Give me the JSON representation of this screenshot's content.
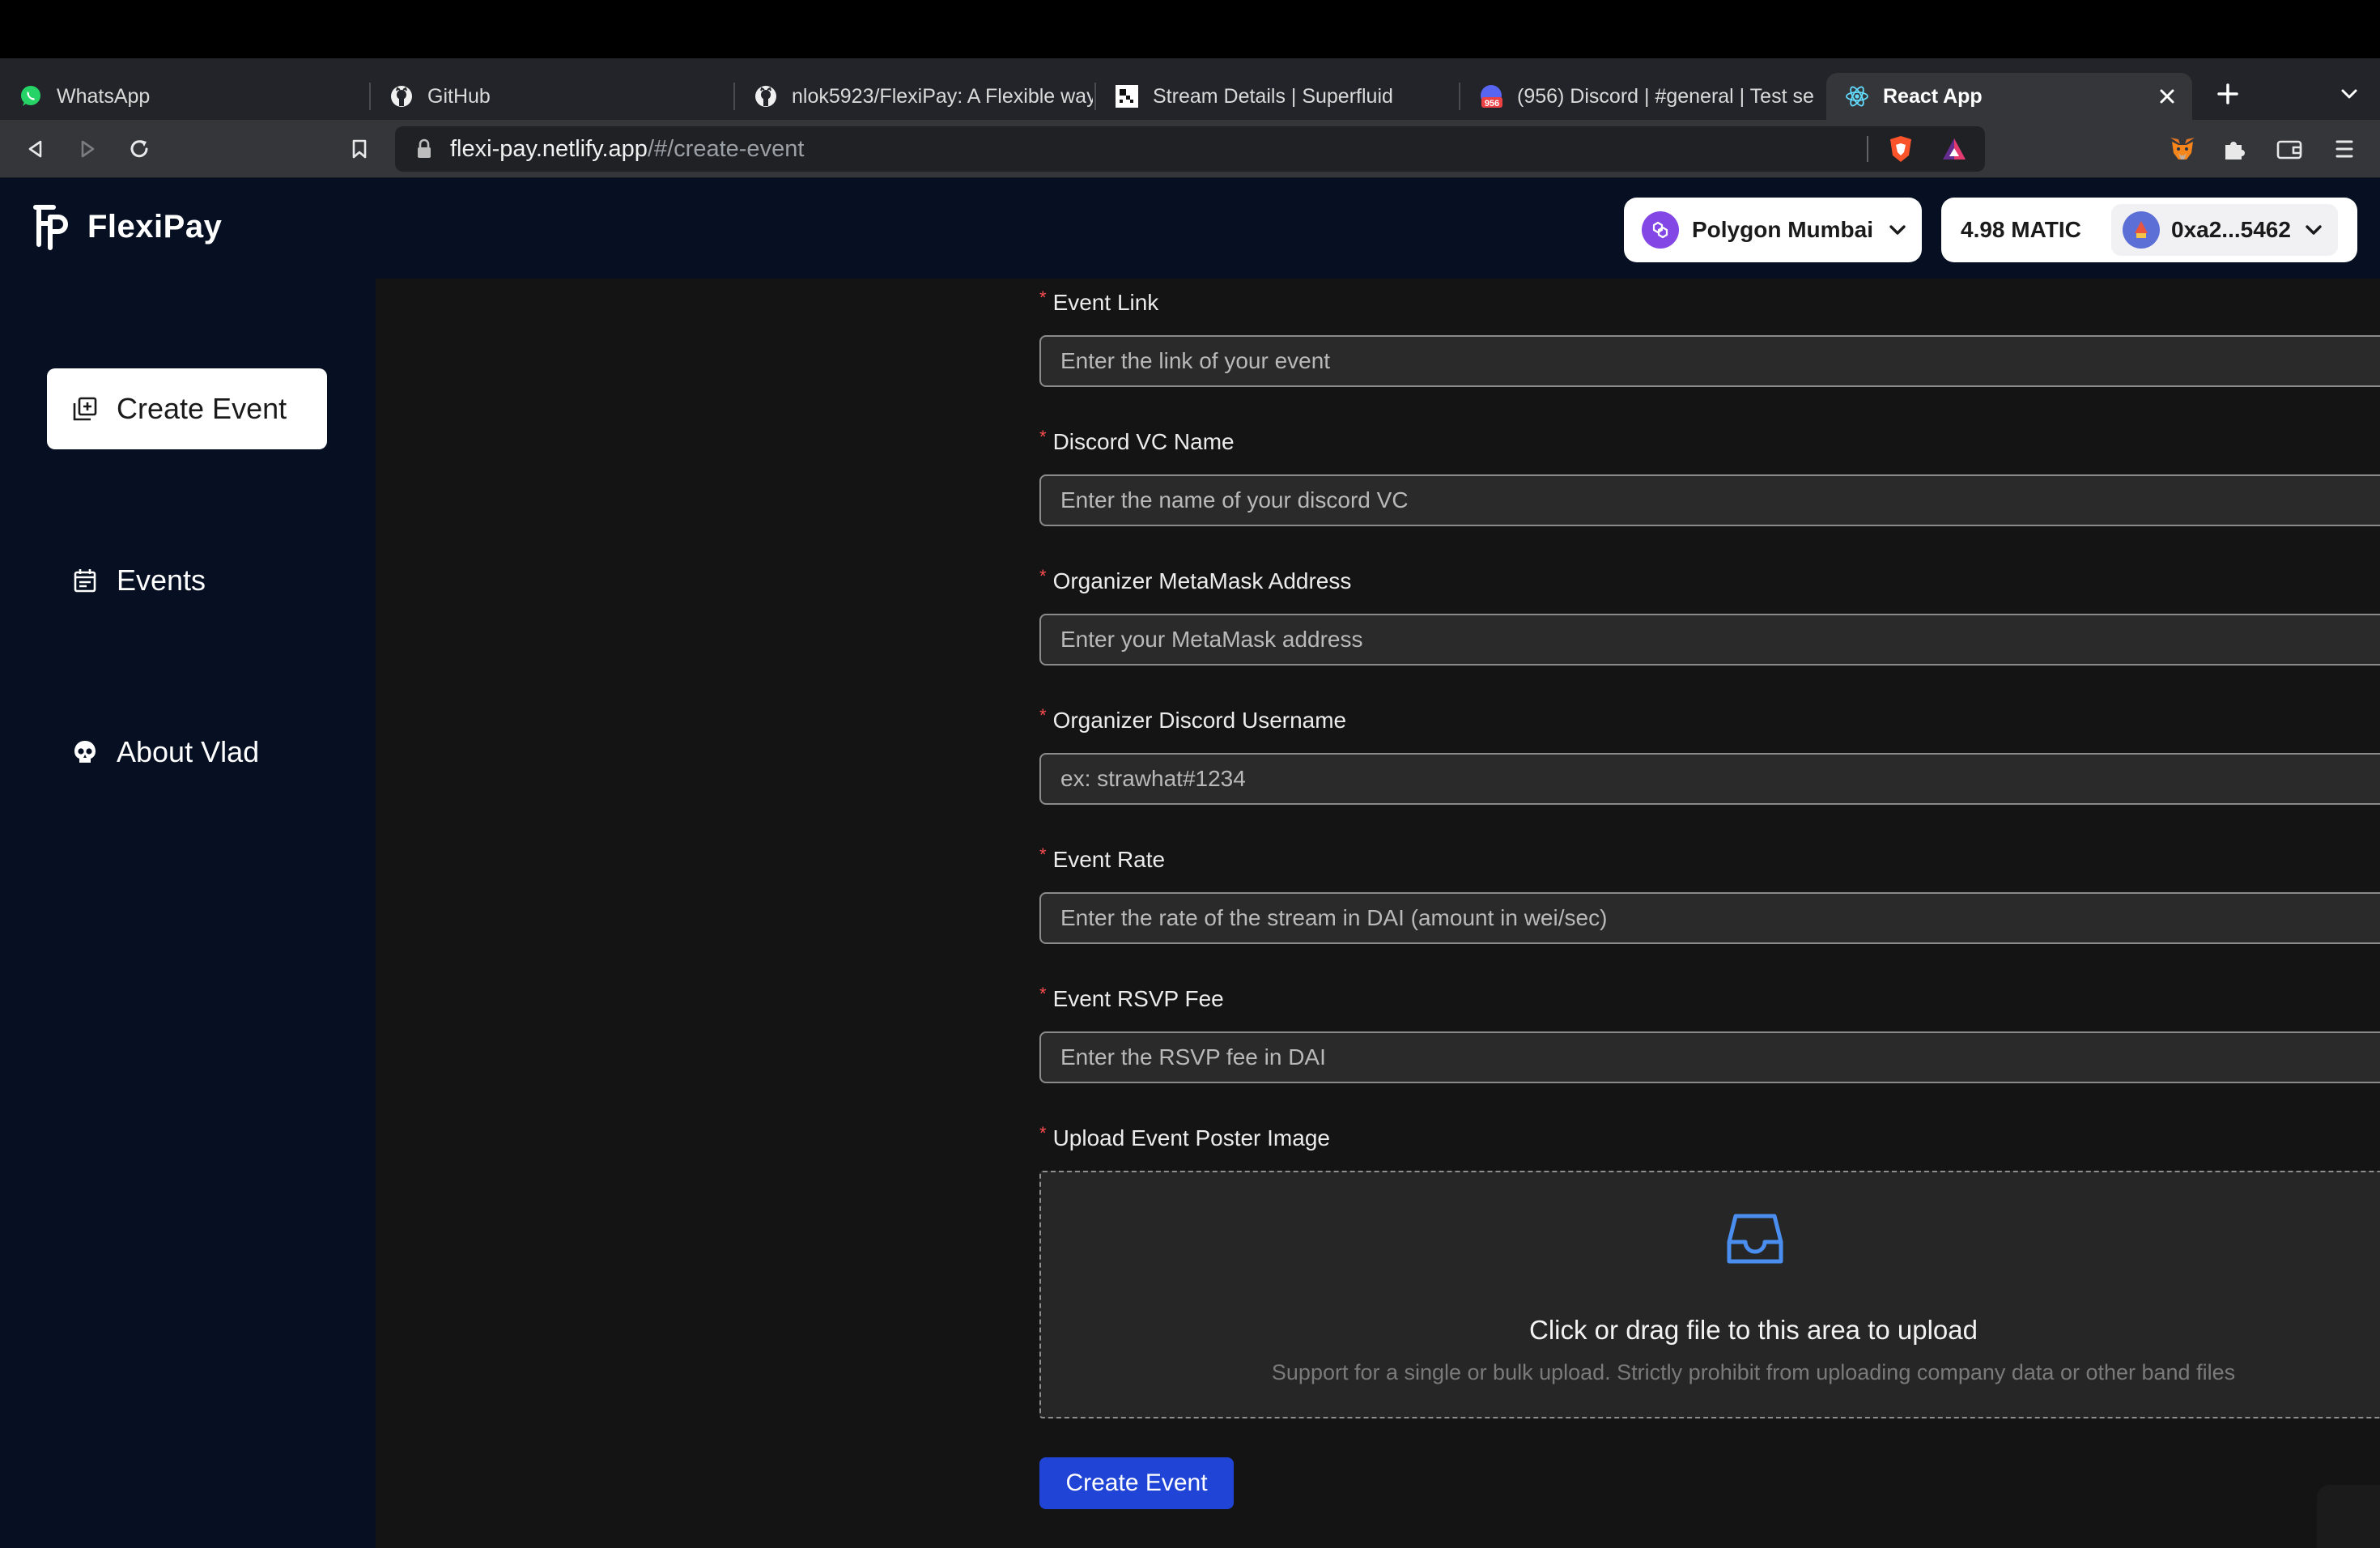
{
  "browser": {
    "tabs": [
      {
        "label": "WhatsApp",
        "icon": "whatsapp-icon"
      },
      {
        "label": "GitHub",
        "icon": "github-icon"
      },
      {
        "label": "nlok5923/FlexiPay: A Flexible way",
        "icon": "github-icon"
      },
      {
        "label": "Stream Details | Superfluid",
        "icon": "superfluid-icon"
      },
      {
        "label": "(956) Discord | #general | Test se",
        "icon": "discord-icon",
        "badge": "956"
      },
      {
        "label": "React App",
        "icon": "react-icon",
        "active": true
      }
    ],
    "url_host": "flexi-pay.netlify.app",
    "url_path": "/#/create-event"
  },
  "app": {
    "name": "FlexiPay",
    "network": "Polygon Mumbai",
    "balance": "4.98 MATIC",
    "address": "0xa2...5462"
  },
  "sidebar": {
    "items": [
      {
        "label": "Create Event",
        "icon": "create-event-icon",
        "active": true
      },
      {
        "label": "Events",
        "icon": "calendar-icon"
      },
      {
        "label": "About Vlad",
        "icon": "skull-icon"
      }
    ]
  },
  "form": {
    "fields": [
      {
        "label": "Event Link",
        "placeholder": "Enter the link of your event",
        "value": ""
      },
      {
        "label": "Discord VC Name",
        "placeholder": "Enter the name of your discord VC",
        "value": ""
      },
      {
        "label": "Organizer MetaMask Address",
        "placeholder": "Enter your MetaMask address",
        "value": ""
      },
      {
        "label": "Organizer Discord Username",
        "placeholder": "ex: strawhat#1234",
        "value": ""
      },
      {
        "label": "Event Rate",
        "placeholder": "Enter the rate of the stream in DAI (amount in wei/sec)",
        "value": ""
      },
      {
        "label": "Event RSVP Fee",
        "placeholder": "Enter the RSVP fee in DAI",
        "value": ""
      }
    ],
    "upload": {
      "label": "Upload Event Poster Image",
      "title": "Click or drag file to this area to upload",
      "hint": "Support for a single or bulk upload. Strictly prohibit from uploading company data or other band files"
    },
    "submit_label": "Create Event",
    "required_marker": "*"
  },
  "colors": {
    "header_bg": "#061022",
    "main_bg": "#141414",
    "primary_button": "#1f44d6",
    "required": "#ff4d4f",
    "upload_icon": "#4a8ef0"
  }
}
